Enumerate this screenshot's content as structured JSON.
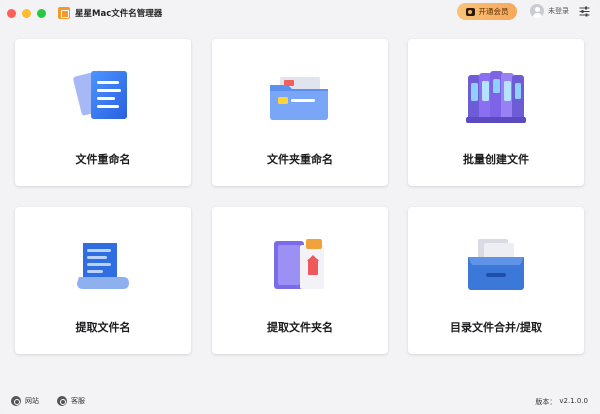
{
  "app": {
    "title": "星星Mac文件名管理器"
  },
  "header": {
    "vip_label": "开通会员",
    "user_label": "未登录"
  },
  "cards": [
    {
      "id": "file-rename",
      "label": "文件重命名"
    },
    {
      "id": "folder-rename",
      "label": "文件夹重命名"
    },
    {
      "id": "batch-create",
      "label": "批量创建文件"
    },
    {
      "id": "extract-file-names",
      "label": "提取文件名"
    },
    {
      "id": "extract-folder-names",
      "label": "提取文件夹名"
    },
    {
      "id": "merge-extract",
      "label": "目录文件合并/提取"
    }
  ],
  "footer": {
    "website_label": "网站",
    "service_label": "客服",
    "version_label": "版本：",
    "version_value": "v2.1.0.0"
  },
  "colors": {
    "accent_vip": "#f6a95a",
    "card_bg": "#ffffff",
    "window_bg": "#f3f3f5"
  }
}
